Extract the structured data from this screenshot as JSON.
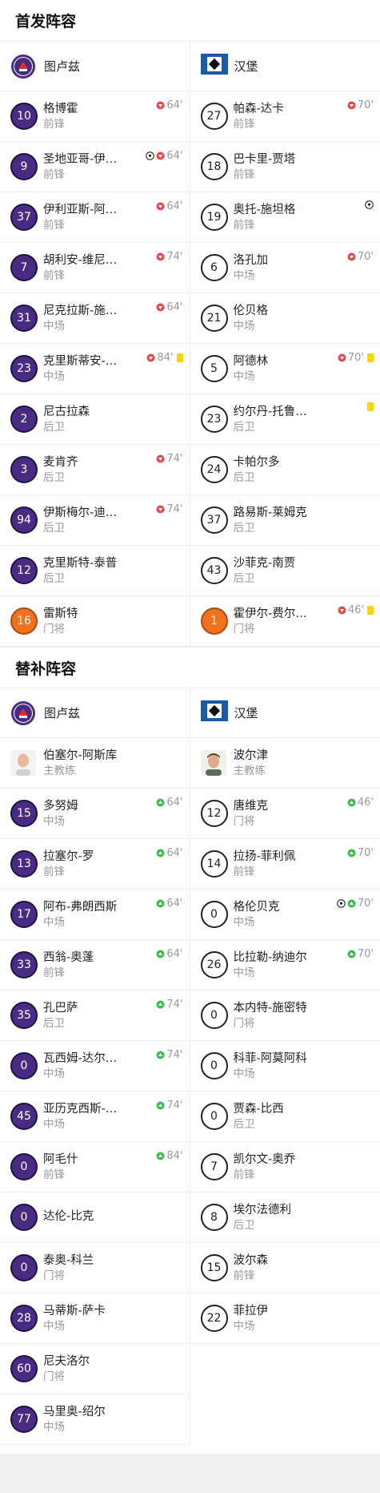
{
  "starting": {
    "title": "首发阵容",
    "home": {
      "team": "图卢兹",
      "players": [
        {
          "num": "10",
          "name": "格博霍",
          "pos": "前锋",
          "kit": "tfc",
          "events": [
            {
              "type": "sub-out",
              "text": "64'"
            }
          ]
        },
        {
          "num": "9",
          "name": "圣地亚哥-伊…",
          "pos": "前锋",
          "kit": "tfc",
          "events": [
            {
              "type": "goal",
              "text": ""
            },
            {
              "type": "sub-out",
              "text": "64'"
            }
          ]
        },
        {
          "num": "37",
          "name": "伊利亚斯-阿…",
          "pos": "前锋",
          "kit": "tfc",
          "events": [
            {
              "type": "sub-out",
              "text": "64'"
            }
          ]
        },
        {
          "num": "7",
          "name": "胡利安-维尼…",
          "pos": "前锋",
          "kit": "tfc",
          "events": [
            {
              "type": "sub-out",
              "text": "74'"
            }
          ]
        },
        {
          "num": "31",
          "name": "尼克拉斯-施…",
          "pos": "中场",
          "kit": "tfc",
          "events": [
            {
              "type": "sub-out",
              "text": "64'"
            }
          ]
        },
        {
          "num": "23",
          "name": "克里斯蒂安-…",
          "pos": "中场",
          "kit": "tfc",
          "events": [
            {
              "type": "sub-out",
              "text": "84'"
            },
            {
              "type": "yellow",
              "text": ""
            }
          ]
        },
        {
          "num": "2",
          "name": "尼古拉森",
          "pos": "后卫",
          "kit": "tfc",
          "events": []
        },
        {
          "num": "3",
          "name": "麦肯齐",
          "pos": "后卫",
          "kit": "tfc",
          "events": [
            {
              "type": "sub-out",
              "text": "74'"
            }
          ]
        },
        {
          "num": "94",
          "name": "伊斯梅尔-迪…",
          "pos": "后卫",
          "kit": "tfc",
          "events": [
            {
              "type": "sub-out",
              "text": "74'"
            }
          ]
        },
        {
          "num": "12",
          "name": "克里斯特-泰普",
          "pos": "后卫",
          "kit": "tfc",
          "events": []
        },
        {
          "num": "16",
          "name": "雷斯特",
          "pos": "门将",
          "kit": "gk",
          "events": []
        }
      ]
    },
    "away": {
      "team": "汉堡",
      "players": [
        {
          "num": "27",
          "name": "帕森-达卡",
          "pos": "前锋",
          "kit": "hsv",
          "events": [
            {
              "type": "sub-out",
              "text": "70'"
            }
          ]
        },
        {
          "num": "18",
          "name": "巴卡里-贾塔",
          "pos": "前锋",
          "kit": "hsv",
          "events": []
        },
        {
          "num": "19",
          "name": "奥托-施坦格",
          "pos": "前锋",
          "kit": "hsv",
          "events": [
            {
              "type": "goal",
              "text": ""
            }
          ]
        },
        {
          "num": "6",
          "name": "洛孔加",
          "pos": "中场",
          "kit": "hsv",
          "events": [
            {
              "type": "sub-out",
              "text": "70'"
            }
          ]
        },
        {
          "num": "21",
          "name": "伦贝格",
          "pos": "中场",
          "kit": "hsv",
          "events": []
        },
        {
          "num": "5",
          "name": "阿德林",
          "pos": "中场",
          "kit": "hsv",
          "events": [
            {
              "type": "sub-out",
              "text": "70'"
            },
            {
              "type": "yellow",
              "text": ""
            }
          ]
        },
        {
          "num": "23",
          "name": "约尔丹-托鲁…",
          "pos": "后卫",
          "kit": "hsv",
          "events": [
            {
              "type": "yellow",
              "text": ""
            }
          ]
        },
        {
          "num": "24",
          "name": "卡帕尔多",
          "pos": "后卫",
          "kit": "hsv",
          "events": []
        },
        {
          "num": "37",
          "name": "路易斯-莱姆克",
          "pos": "后卫",
          "kit": "hsv",
          "events": []
        },
        {
          "num": "43",
          "name": "沙菲克-南贾",
          "pos": "后卫",
          "kit": "hsv",
          "events": []
        },
        {
          "num": "1",
          "name": "霍伊尔-费尔…",
          "pos": "门将",
          "kit": "gk",
          "events": [
            {
              "type": "sub-out",
              "text": "46'"
            },
            {
              "type": "yellow",
              "text": ""
            }
          ]
        }
      ]
    }
  },
  "subs": {
    "title": "替补阵容",
    "home": {
      "team": "图卢兹",
      "coach": {
        "name": "伯塞尔-阿斯库",
        "role": "主教练"
      },
      "players": [
        {
          "num": "15",
          "name": "多努姆",
          "pos": "中场",
          "kit": "tfc",
          "events": [
            {
              "type": "sub-in",
              "text": "64'"
            }
          ]
        },
        {
          "num": "13",
          "name": "拉塞尔-罗",
          "pos": "前锋",
          "kit": "tfc",
          "events": [
            {
              "type": "sub-in",
              "text": "64'"
            }
          ]
        },
        {
          "num": "17",
          "name": "阿布-弗朗西斯",
          "pos": "中场",
          "kit": "tfc",
          "events": [
            {
              "type": "sub-in",
              "text": "64'"
            }
          ]
        },
        {
          "num": "33",
          "name": "西翁-奥蓬",
          "pos": "前锋",
          "kit": "tfc",
          "events": [
            {
              "type": "sub-in",
              "text": "64'"
            }
          ]
        },
        {
          "num": "35",
          "name": "孔巴萨",
          "pos": "后卫",
          "kit": "tfc",
          "events": [
            {
              "type": "sub-in",
              "text": "74'"
            }
          ]
        },
        {
          "num": "0",
          "name": "瓦西姆-达尔…",
          "pos": "中场",
          "kit": "tfc",
          "events": [
            {
              "type": "sub-in",
              "text": "74'"
            }
          ]
        },
        {
          "num": "45",
          "name": "亚历克西斯-…",
          "pos": "中场",
          "kit": "tfc",
          "events": [
            {
              "type": "sub-in",
              "text": "74'"
            }
          ]
        },
        {
          "num": "0",
          "name": "阿毛什",
          "pos": "前锋",
          "kit": "tfc",
          "events": [
            {
              "type": "sub-in",
              "text": "84'"
            }
          ]
        },
        {
          "num": "0",
          "name": "达伦-比克",
          "pos": "",
          "kit": "tfc",
          "events": []
        },
        {
          "num": "0",
          "name": "泰奥-科兰",
          "pos": "门将",
          "kit": "tfc",
          "events": []
        },
        {
          "num": "28",
          "name": "马蒂斯-萨卡",
          "pos": "中场",
          "kit": "tfc",
          "events": []
        },
        {
          "num": "60",
          "name": "尼夫洛尔",
          "pos": "门将",
          "kit": "tfc",
          "events": []
        },
        {
          "num": "77",
          "name": "马里奥-绍尔",
          "pos": "中场",
          "kit": "tfc",
          "events": []
        }
      ]
    },
    "away": {
      "team": "汉堡",
      "coach": {
        "name": "波尔津",
        "role": "主教练"
      },
      "players": [
        {
          "num": "12",
          "name": "唐维克",
          "pos": "门将",
          "kit": "hsv",
          "events": [
            {
              "type": "sub-in",
              "text": "46'"
            }
          ]
        },
        {
          "num": "14",
          "name": "拉扬-菲利佩",
          "pos": "前锋",
          "kit": "hsv",
          "events": [
            {
              "type": "sub-in",
              "text": "70'"
            }
          ]
        },
        {
          "num": "0",
          "name": "格伦贝克",
          "pos": "中场",
          "kit": "hsv",
          "events": [
            {
              "type": "goal",
              "text": ""
            },
            {
              "type": "sub-in",
              "text": "70'"
            }
          ]
        },
        {
          "num": "26",
          "name": "比拉勒-纳迪尔",
          "pos": "中场",
          "kit": "hsv",
          "events": [
            {
              "type": "sub-in",
              "text": "70'"
            }
          ]
        },
        {
          "num": "0",
          "name": "本内特-施密特",
          "pos": "门将",
          "kit": "hsv",
          "events": []
        },
        {
          "num": "0",
          "name": "科菲-阿莫阿科",
          "pos": "中场",
          "kit": "hsv",
          "events": []
        },
        {
          "num": "0",
          "name": "贾森-比西",
          "pos": "后卫",
          "kit": "hsv",
          "events": []
        },
        {
          "num": "7",
          "name": "凯尔文-奥乔",
          "pos": "前锋",
          "kit": "hsv",
          "events": []
        },
        {
          "num": "8",
          "name": "埃尔法德利",
          "pos": "后卫",
          "kit": "hsv",
          "events": []
        },
        {
          "num": "15",
          "name": "波尔森",
          "pos": "前锋",
          "kit": "hsv",
          "events": []
        },
        {
          "num": "22",
          "name": "菲拉伊",
          "pos": "中场",
          "kit": "hsv",
          "events": []
        }
      ]
    }
  },
  "colors": {
    "tfc_purple": "#4a2b83",
    "gk_orange": "#f2711c",
    "sub_out_red": "#e34b4b",
    "sub_in_green": "#3dba52",
    "yellow_card": "#ffd400"
  },
  "icons": {
    "home_logo": "toulouse-crest-icon",
    "away_logo": "hamburg-diamond-icon",
    "goal": "soccer-ball-icon",
    "sub_out": "sub-out-arrow-icon",
    "sub_in": "sub-in-arrow-icon",
    "card": "yellow-card-icon"
  }
}
